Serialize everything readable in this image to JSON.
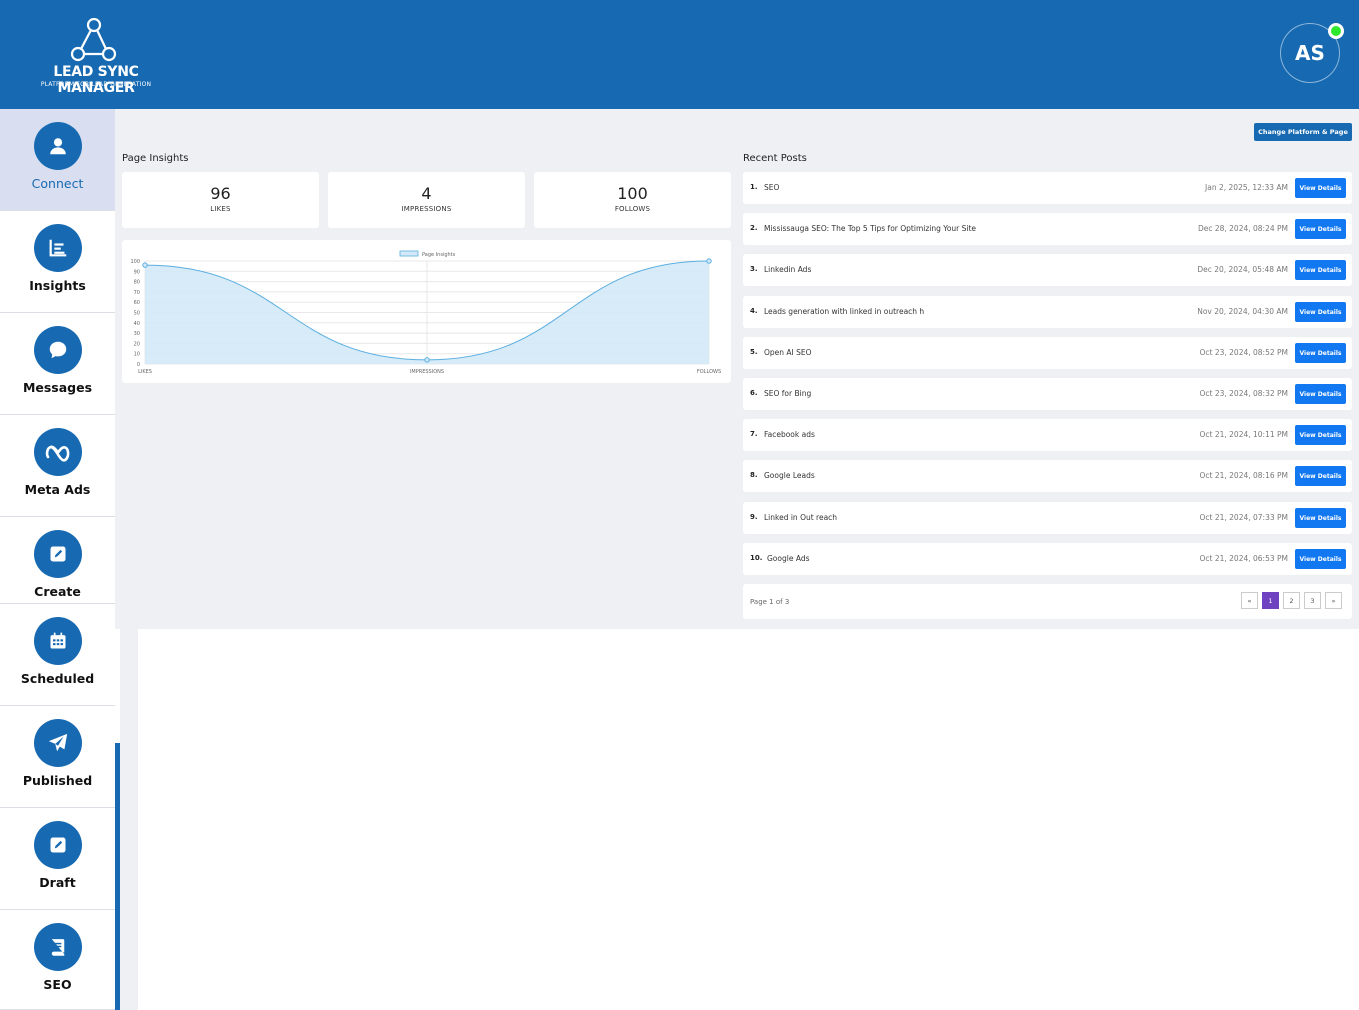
{
  "brand": {
    "title": "LEAD SYNC MANAGER",
    "subtitle": "PLATFORM FOR LEAD GENERATION"
  },
  "user": {
    "initials": "AS",
    "status_color": "#2ee82e"
  },
  "colors": {
    "primary": "#176ab2",
    "button_blue": "#1278f2",
    "active_page": "#6f42c1"
  },
  "sidebar": {
    "items": [
      {
        "label": "Connect",
        "icon": "user-icon",
        "active": true
      },
      {
        "label": "Insights",
        "icon": "chart-list-icon"
      },
      {
        "label": "Messages",
        "icon": "chat-bubble-icon"
      },
      {
        "label": "Meta Ads",
        "icon": "meta-icon"
      },
      {
        "label": "Create",
        "icon": "edit-icon"
      },
      {
        "label": "Scheduled",
        "icon": "calendar-icon"
      },
      {
        "label": "Published",
        "icon": "paper-plane-icon"
      },
      {
        "label": "Draft",
        "icon": "draft-edit-icon"
      },
      {
        "label": "SEO",
        "icon": "book-icon"
      }
    ]
  },
  "actions": {
    "change_platform": "Change Platform & Page"
  },
  "insights": {
    "title": "Page Insights",
    "stats": [
      {
        "value": "96",
        "label": "LIKES"
      },
      {
        "value": "4",
        "label": "IMPRESSIONS"
      },
      {
        "value": "100",
        "label": "FOLLOWS"
      }
    ]
  },
  "chart_data": {
    "type": "area",
    "title": "",
    "legend": "Page Insights",
    "legend_position": "top-center",
    "categories": [
      "LIKES",
      "IMPRESSIONS",
      "FOLLOWS"
    ],
    "series": [
      {
        "name": "Page Insights",
        "values": [
          96,
          4,
          100
        ]
      }
    ],
    "ylim": [
      0,
      100
    ],
    "y_ticks": [
      "100",
      "90",
      "80",
      "70",
      "60",
      "50",
      "40",
      "30",
      "20",
      "10",
      "0"
    ],
    "grid": true,
    "line_color": "#5aaee0",
    "fill_color": "#d3e9f7"
  },
  "posts": {
    "title": "Recent Posts",
    "button_label": "View Details",
    "items": [
      {
        "num": "1.",
        "title": "SEO",
        "date": "Jan 2, 2025, 12:33 AM"
      },
      {
        "num": "2.",
        "title": "Mississauga SEO: The Top 5 Tips for Optimizing Your Site",
        "date": "Dec 28, 2024, 08:24 PM"
      },
      {
        "num": "3.",
        "title": "Linkedin Ads",
        "date": "Dec 20, 2024, 05:48 AM"
      },
      {
        "num": "4.",
        "title": "Leads generation with linked in outreach h",
        "date": "Nov 20, 2024, 04:30 AM"
      },
      {
        "num": "5.",
        "title": "Open AI SEO",
        "date": "Oct 23, 2024, 08:52 PM"
      },
      {
        "num": "6.",
        "title": "SEO for Bing",
        "date": "Oct 23, 2024, 08:32 PM"
      },
      {
        "num": "7.",
        "title": "Facebook ads",
        "date": "Oct 21, 2024, 10:11 PM"
      },
      {
        "num": "8.",
        "title": "Google Leads",
        "date": "Oct 21, 2024, 08:16 PM"
      },
      {
        "num": "9.",
        "title": "Linked in Out reach",
        "date": "Oct 21, 2024, 07:33 PM"
      },
      {
        "num": "10.",
        "title": "Google Ads",
        "date": "Oct 21, 2024, 06:53 PM"
      }
    ]
  },
  "pagination": {
    "text": "Page 1 of 3",
    "prev": "«",
    "next": "»",
    "pages": [
      "1",
      "2",
      "3"
    ],
    "current": "1"
  }
}
